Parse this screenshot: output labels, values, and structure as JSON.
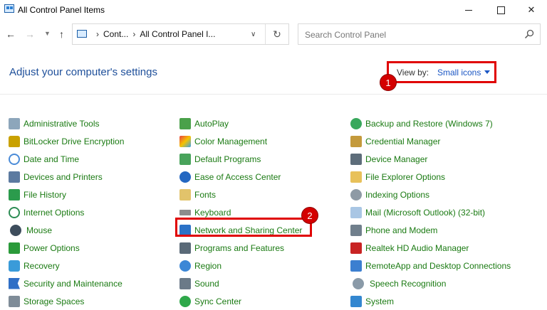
{
  "window": {
    "title": "All Control Panel Items"
  },
  "nav": {
    "address": {
      "segment1": "Cont...",
      "segment2": "All Control Panel I..."
    },
    "search_placeholder": "Search Control Panel"
  },
  "header": {
    "heading": "Adjust your computer's settings",
    "view_by_label": "View by:",
    "view_by_value": "Small icons"
  },
  "annotations": {
    "badge1": "1",
    "badge2": "2"
  },
  "items": {
    "col1": [
      {
        "label": "Administrative Tools",
        "icon": "tools-icon"
      },
      {
        "label": "BitLocker Drive Encryption",
        "icon": "bitlocker-icon"
      },
      {
        "label": "Date and Time",
        "icon": "clock-icon"
      },
      {
        "label": "Devices and Printers",
        "icon": "printer-icon"
      },
      {
        "label": "File History",
        "icon": "file-history-icon"
      },
      {
        "label": "Internet Options",
        "icon": "globe-icon"
      },
      {
        "label": "Mouse",
        "icon": "mouse-icon"
      },
      {
        "label": "Power Options",
        "icon": "power-icon"
      },
      {
        "label": "Recovery",
        "icon": "recovery-icon"
      },
      {
        "label": "Security and Maintenance",
        "icon": "flag-icon"
      },
      {
        "label": "Storage Spaces",
        "icon": "storage-icon"
      }
    ],
    "col2": [
      {
        "label": "AutoPlay",
        "icon": "autoplay-icon"
      },
      {
        "label": "Color Management",
        "icon": "color-icon"
      },
      {
        "label": "Default Programs",
        "icon": "default-programs-icon"
      },
      {
        "label": "Ease of Access Center",
        "icon": "ease-of-access-icon"
      },
      {
        "label": "Fonts",
        "icon": "fonts-icon"
      },
      {
        "label": "Keyboard",
        "icon": "keyboard-icon"
      },
      {
        "label": "Network and Sharing Center",
        "icon": "network-icon"
      },
      {
        "label": "Programs and Features",
        "icon": "programs-icon"
      },
      {
        "label": "Region",
        "icon": "region-icon"
      },
      {
        "label": "Sound",
        "icon": "sound-icon"
      },
      {
        "label": "Sync Center",
        "icon": "sync-icon"
      }
    ],
    "col3": [
      {
        "label": "Backup and Restore (Windows 7)",
        "icon": "backup-icon"
      },
      {
        "label": "Credential Manager",
        "icon": "credential-icon"
      },
      {
        "label": "Device Manager",
        "icon": "device-manager-icon"
      },
      {
        "label": "File Explorer Options",
        "icon": "folder-icon"
      },
      {
        "label": "Indexing Options",
        "icon": "indexing-icon"
      },
      {
        "label": "Mail (Microsoft Outlook) (32-bit)",
        "icon": "mail-icon"
      },
      {
        "label": "Phone and Modem",
        "icon": "phone-icon"
      },
      {
        "label": "Realtek HD Audio Manager",
        "icon": "realtek-icon"
      },
      {
        "label": "RemoteApp and Desktop Connections",
        "icon": "remote-icon"
      },
      {
        "label": "Speech Recognition",
        "icon": "microphone-icon"
      },
      {
        "label": "System",
        "icon": "system-icon"
      }
    ]
  },
  "colors": {
    "heading": "#1e4f9a",
    "link": "#1a7a12",
    "highlight": "#e00000",
    "accent": "#1a56c4"
  }
}
